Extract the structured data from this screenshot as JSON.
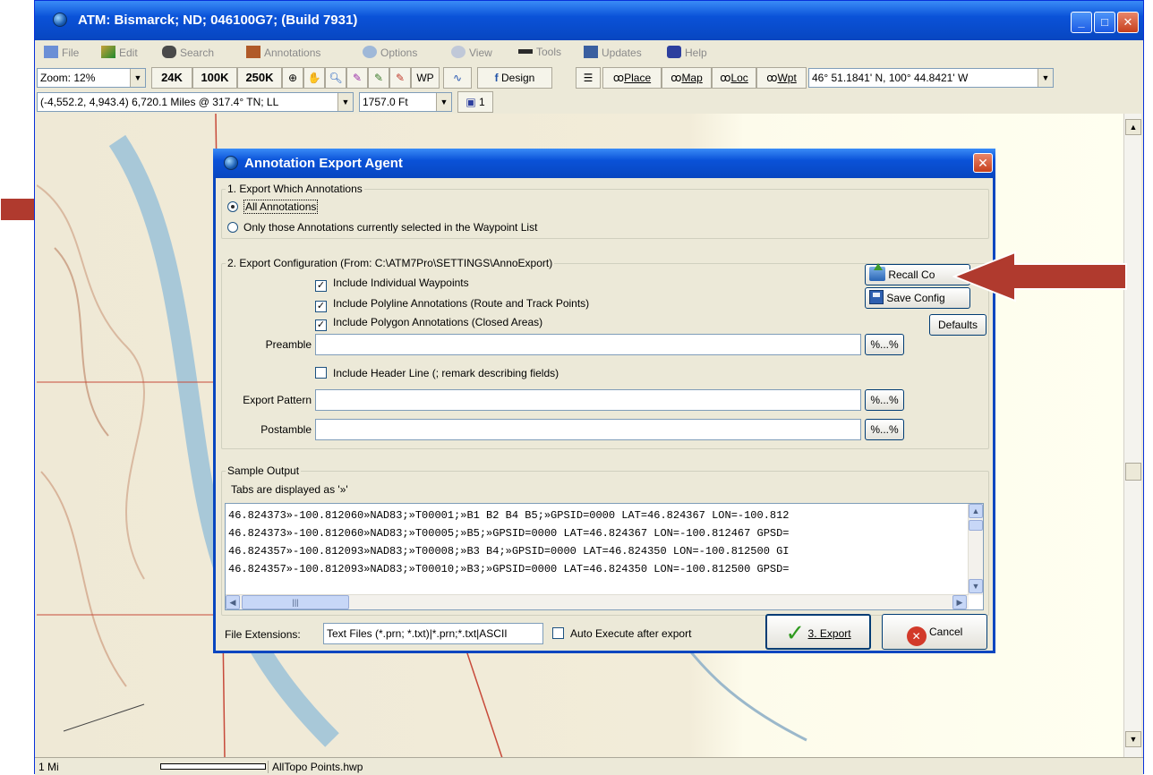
{
  "window": {
    "title": "ATM: Bismarck; ND; 046100G7; (Build 7931)"
  },
  "menu": [
    "File",
    "Edit",
    "Search",
    "Annotations",
    "Options",
    "View",
    "Tools",
    "Updates",
    "Help"
  ],
  "toolbar": {
    "zoom": "Zoom: 12%",
    "scale_24k": "24K",
    "scale_100k": "100K",
    "scale_250k": "250K",
    "wp_label": "WP",
    "design_label": "Design",
    "place_label": "Place",
    "map_label": "Map",
    "loc_label": "Loc",
    "wpt_label": "Wpt",
    "coords": "46° 51.1841' N, 100° 44.8421' W",
    "distance": "(-4,552.2, 4,943.4) 6,720.1 Miles @ 317.4° TN; LL",
    "elevation": "1757.0 Ft",
    "layer_count": "1"
  },
  "status": {
    "scale": "1 Mi",
    "file": "AllTopo Points.hwp"
  },
  "dialog": {
    "title": "Annotation Export Agent",
    "section1_label": "1. Export Which Annotations",
    "opt_all": "All Annotations",
    "opt_selected": "Only those Annotations currently selected in the Waypoint List",
    "section2_label": "2. Export Configuration  (From: C:\\ATM7Pro\\SETTINGS\\AnnoExport)",
    "chk_waypoints": "Include Individual Waypoints",
    "chk_polyline": "Include Polyline Annotations (Route and Track Points)",
    "chk_polygon": "Include Polygon Annotations (Closed Areas)",
    "recall_config": "Recall Co",
    "save_config": "Save Config",
    "defaults": "Defaults",
    "preamble_label": "Preamble",
    "header_line": "Include Header Line (; remark describing fields)",
    "export_pattern_label": "Export Pattern",
    "postamble_label": "Postamble",
    "macro_button": "%...%",
    "sample_label": "Sample Output",
    "tabs_note": "Tabs are displayed as '»'",
    "sample_lines": [
      "46.824373»-100.812060»NAD83;»T00001;»B1 B2 B4 B5;»GPSID=0000 LAT=46.824367 LON=-100.812",
      "46.824373»-100.812060»NAD83;»T00005;»B5;»GPSID=0000 LAT=46.824367 LON=-100.812467 GPSD=",
      "46.824357»-100.812093»NAD83;»T00008;»B3 B4;»GPSID=0000 LAT=46.824350 LON=-100.812500 GI",
      "46.824357»-100.812093»NAD83;»T00010;»B3;»GPSID=0000 LAT=46.824350 LON=-100.812500 GPSD="
    ],
    "file_ext_label": "File Extensions:",
    "file_ext_value": "Text Files (*.prn; *.txt)|*.prn;*.txt|ASCII",
    "auto_execute": "Auto Execute after export",
    "export_button": "3. Export",
    "cancel_button": "Cancel"
  },
  "colors": {
    "xp_blue": "#0846c0",
    "arrow_red": "#b03a2e"
  }
}
